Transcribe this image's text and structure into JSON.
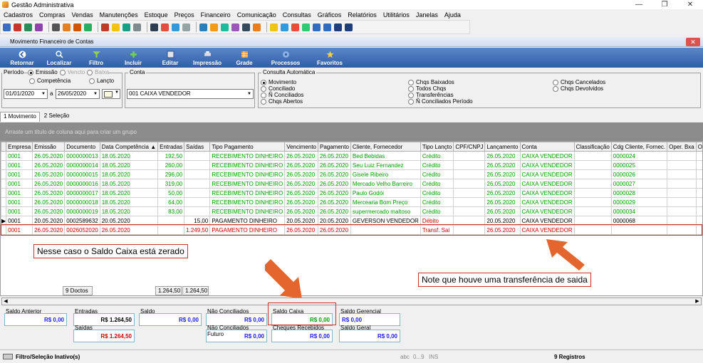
{
  "window": {
    "title": "Gestão Administrativa",
    "min": "—",
    "restore": "❐",
    "close": "✕"
  },
  "menu": [
    "Cadastros",
    "Compras",
    "Vendas",
    "Manutenções",
    "Estoque",
    "Preços",
    "Financeiro",
    "Comunicação",
    "Consultas",
    "Gráficos",
    "Relatórios",
    "Utilitários",
    "Janelas",
    "Ajuda"
  ],
  "child_window": {
    "title": "Movimento Financeiro de Contas",
    "close": "✕"
  },
  "toolbar": [
    "Retornar",
    "Localizar",
    "Filtro",
    "Incluir",
    "Editar",
    "Impressão",
    "Grade",
    "Processos",
    "Favoritos"
  ],
  "periodo": {
    "label": "Período",
    "opt_emissao": "Emissão",
    "opt_vencto": "Vencto",
    "opt_baixa": "Baixa",
    "opt_competencia": "Competência",
    "opt_lancto": "Lançto",
    "date_from": "01/01/2020",
    "date_sep": "a",
    "date_to": "26/05/2020"
  },
  "conta": {
    "label": "Conta",
    "value": "001   CAIXA VENDEDOR"
  },
  "consulta": {
    "label": "Consulta Automática",
    "col1": [
      "Movimento",
      "Conciliado",
      "Ñ Conciliados",
      "Chqs Abertos"
    ],
    "col2": [
      "Chqs Baixados",
      "Todos Chqs",
      "Transferências",
      "Ñ Conciliados Período"
    ],
    "col3": [
      "Chqs Cancelados",
      "Chqs Devolvidos"
    ]
  },
  "tabs": [
    "1 Movimento",
    "2 Seleção"
  ],
  "grid": {
    "group_hint": "Arraste um título de coluna aqui para criar um grupo",
    "columns": [
      "Empresa",
      "Emissão",
      "Documento",
      "Data Competência",
      "Entradas",
      "Saídas",
      "Tipo Pagamento",
      "Vencimento",
      "Pagamento",
      "Cliente, Fornecedor",
      "Tipo Lançto",
      "CPF/CNPJ",
      "Lançamento",
      "Conta",
      "Classificação",
      "Cdg Cliente, Fornec.",
      "Oper. Bxa",
      "Operacao"
    ],
    "rows": [
      {
        "c": "g",
        "cells": [
          "0001",
          "26.05.2020",
          "0000000013",
          "18.05.2020",
          "192,50",
          "",
          "RECEBIMENTO DINHEIRO",
          "26.05.2020",
          "26.05.2020",
          "Bed Bebidas",
          "Crédito",
          "",
          "26.05.2020",
          "CAIXA VENDEDOR",
          "",
          "0000024",
          "",
          ""
        ]
      },
      {
        "c": "g",
        "cells": [
          "0001",
          "26.05.2020",
          "0000000014",
          "18.05.2020",
          "260,00",
          "",
          "RECEBIMENTO DINHEIRO",
          "26.05.2020",
          "26.05.2020",
          "Seu Luiz Fernandez",
          "Crédito",
          "",
          "26.05.2020",
          "CAIXA VENDEDOR",
          "",
          "0000025",
          "",
          ""
        ]
      },
      {
        "c": "g",
        "cells": [
          "0001",
          "26.05.2020",
          "0000000015",
          "18.05.2020",
          "296,00",
          "",
          "RECEBIMENTO DINHEIRO",
          "26.05.2020",
          "26.05.2020",
          "Gisele Ribeiro",
          "Crédito",
          "",
          "26.05.2020",
          "CAIXA VENDEDOR",
          "",
          "0000026",
          "",
          ""
        ]
      },
      {
        "c": "g",
        "cells": [
          "0001",
          "26.05.2020",
          "0000000016",
          "18.05.2020",
          "319,00",
          "",
          "RECEBIMENTO DINHEIRO",
          "26.05.2020",
          "26.05.2020",
          "Mercado Velho Barreiro",
          "Crédito",
          "",
          "26.05.2020",
          "CAIXA VENDEDOR",
          "",
          "0000027",
          "",
          ""
        ]
      },
      {
        "c": "g",
        "cells": [
          "0001",
          "26.05.2020",
          "0000000017",
          "18.05.2020",
          "50,00",
          "",
          "RECEBIMENTO DINHEIRO",
          "26.05.2020",
          "26.05.2020",
          "Paulo Godói",
          "Crédito",
          "",
          "26.05.2020",
          "CAIXA VENDEDOR",
          "",
          "0000028",
          "",
          ""
        ]
      },
      {
        "c": "g",
        "cells": [
          "0001",
          "26.05.2020",
          "0000000018",
          "18.05.2020",
          "64,00",
          "",
          "RECEBIMENTO DINHEIRO",
          "26.05.2020",
          "26.05.2020",
          "Mercearia Bom Preço",
          "Crédito",
          "",
          "26.05.2020",
          "CAIXA VENDEDOR",
          "",
          "0000029",
          "",
          ""
        ]
      },
      {
        "c": "g",
        "cells": [
          "0001",
          "26.05.2020",
          "0000000019",
          "18.05.2020",
          "83,00",
          "",
          "RECEBIMENTO DINHEIRO",
          "26.05.2020",
          "26.05.2020",
          "supermercado maltoso",
          "Crédito",
          "",
          "26.05.2020",
          "CAIXA VENDEDOR",
          "",
          "0000034",
          "",
          ""
        ]
      },
      {
        "c": "k",
        "cells": [
          "0001",
          "20.05.2020",
          "0002589632",
          "20.05.2020",
          "",
          "15,00",
          "PAGAMENTO DINHEIRO",
          "20.05.2020",
          "20.05.2020",
          "GEVERSON VENDEDOR",
          "Débito",
          "",
          "20.05.2020",
          "CAIXA VENDEDOR",
          "",
          "0000068",
          "",
          ""
        ]
      },
      {
        "c": "r",
        "cells": [
          "0001",
          "26.05.2020",
          "0026052020",
          "26.05.2020",
          "",
          "1.249,50",
          "PAGAMENTO DINHEIRO",
          "26.05.2020",
          "26.05.2020",
          "",
          "Transf. Sai",
          "",
          "26.05.2020",
          "CAIXA VENDEDOR",
          "",
          "",
          "",
          ""
        ]
      }
    ],
    "row_indicator": "▶"
  },
  "totals": {
    "count": "9 Doctos",
    "entradas": "1.264,50",
    "saidas": "1.264,50"
  },
  "annotations": {
    "left": "Nesse caso o Saldo Caixa está zerado",
    "right": "Note que houve uma transferência de saida"
  },
  "balances": {
    "saldo_anterior": {
      "label": "Saldo Anterior",
      "value": "R$ 0,00"
    },
    "entradas": {
      "label": "Entradas",
      "value": "R$ 1.264,50"
    },
    "saidas": {
      "label": "Saídas",
      "value": "R$ 1.264,50"
    },
    "saldo": {
      "label": "Saldo",
      "value": "R$ 0,00"
    },
    "nao_conciliados": {
      "label": "Não Conciliados",
      "value": "R$ 0,00"
    },
    "nao_conciliados_futuro": {
      "label": "Não Conciliados Futuro",
      "value": "R$ 0,00"
    },
    "saldo_caixa": {
      "label": "Saldo Caixa",
      "value": "R$ 0,00"
    },
    "cheques_recebidos": {
      "label": "Cheques Recebidos",
      "value": "R$ 0,00"
    },
    "saldo_gerencial": {
      "label": "Saldo Gerencial",
      "value": "R$ 0,00"
    },
    "saldo_geral": {
      "label": "Saldo Geral",
      "value": "R$ 0,00"
    }
  },
  "status": {
    "filter": "Filtro/Seleção Inativo(s)",
    "abc": "abc",
    "range": "0...9",
    "ins": "INS",
    "records": "9 Registros"
  }
}
